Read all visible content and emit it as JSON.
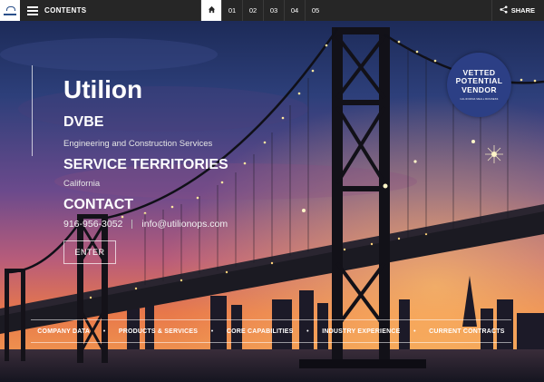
{
  "topbar": {
    "contents_label": "CONTENTS",
    "pages": [
      "01",
      "02",
      "03",
      "04",
      "05"
    ],
    "share_label": "SHARE"
  },
  "hero": {
    "title": "Utilion",
    "dvbe": "DVBE",
    "services": "Engineering and Construction Services",
    "territories_heading": "SERVICE TERRITORIES",
    "territory": "California",
    "contact_heading": "CONTACT",
    "phone": "916-956-3052",
    "email": "info@utilionops.com",
    "enter_label": "ENTER"
  },
  "badge": {
    "line1": "VETTED",
    "line2": "POTENTIAL",
    "line3": "VENDOR",
    "small": "CALIFORNIA SMALL BUSINESS"
  },
  "bottom_nav": {
    "items": [
      "COMPANY DATA",
      "PRODUCTS & SERVICES",
      "CORE CAPABILITIES",
      "INDUSTRY EXPERIENCE",
      "CURRENT CONTRACTS"
    ]
  },
  "colors": {
    "topbar": "#262626",
    "badge": "#2c3f85",
    "sky_top": "#1e2c5e",
    "sky_mid": "#7a4a8a",
    "sky_low": "#e0704a"
  }
}
